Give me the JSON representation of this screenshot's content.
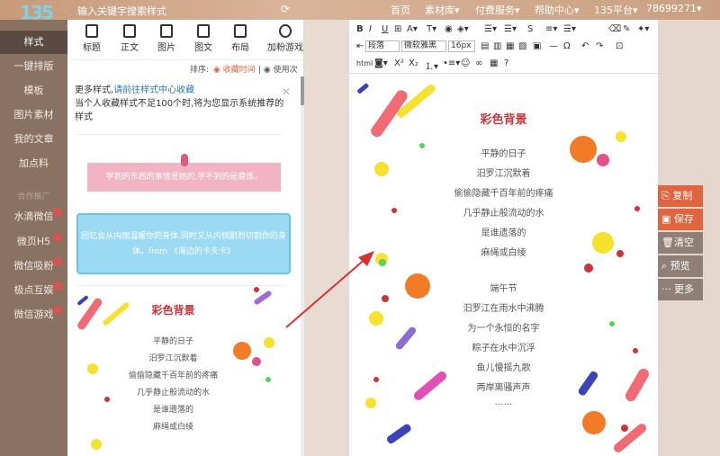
{
  "header": {
    "logo": "135",
    "search_placeholder": "输入关键字搜索样式",
    "nav": [
      "首页",
      "素材库▾",
      "付费服务▾",
      "帮助中心▾",
      "135平台▾",
      "78699271▾"
    ]
  },
  "sidebar": {
    "items": [
      {
        "label": "样式"
      },
      {
        "label": "一键排版"
      },
      {
        "label": "模板"
      },
      {
        "label": "图片素材"
      },
      {
        "label": "我的文章"
      },
      {
        "label": "加点料"
      },
      {
        "label": "水滴微信"
      },
      {
        "label": "微页H5"
      },
      {
        "label": "微信吸粉"
      },
      {
        "label": "极点互娱"
      },
      {
        "label": "微信游戏"
      }
    ],
    "section_label": "合作推广"
  },
  "style_tabs": [
    "标题",
    "正文",
    "图片",
    "图文",
    "布局",
    "加粉游戏"
  ],
  "sort": {
    "label": "排序:",
    "option_time": "收藏时间",
    "option_count": "使用次数"
  },
  "notice": {
    "prefix": "更多样式,",
    "link": "请前往样式中心收藏",
    "text": "当个人收藏样式不足100个时,将为您显示系统推荐的样式"
  },
  "samples": {
    "pink_text": "学到的东西的事情是她的,学不到的是磨炼。",
    "blue_text": "回忆会从内侧温暖你的身体,同时又从内侧剧烈切割你的身体。from 《海边的卡夫卡》"
  },
  "poem": {
    "title": "彩色背景",
    "stanza1": [
      "平静的日子",
      "汨罗江沉默着",
      "偷偷隐藏千百年前的疼痛",
      "几乎静止般流动的水",
      "是谁遗落的",
      "麻绳或白绫"
    ],
    "stanza2": [
      "端午节",
      "汨罗江在雨水中沸腾",
      "为一个永恒的名字",
      "粽子在水中沉浮",
      "鱼儿慢摇九歌",
      "两岸离骚声声",
      "……"
    ]
  },
  "toolbar": {
    "font_block": "段落",
    "font_family": "微软雅黑",
    "font_size": "16px"
  },
  "actions": [
    "复制",
    "保存",
    "清空",
    "预览",
    "更多"
  ],
  "colors": {
    "accent": "#e0643e",
    "poem_title": "#c8353a",
    "sidebar": "#8a7263"
  }
}
